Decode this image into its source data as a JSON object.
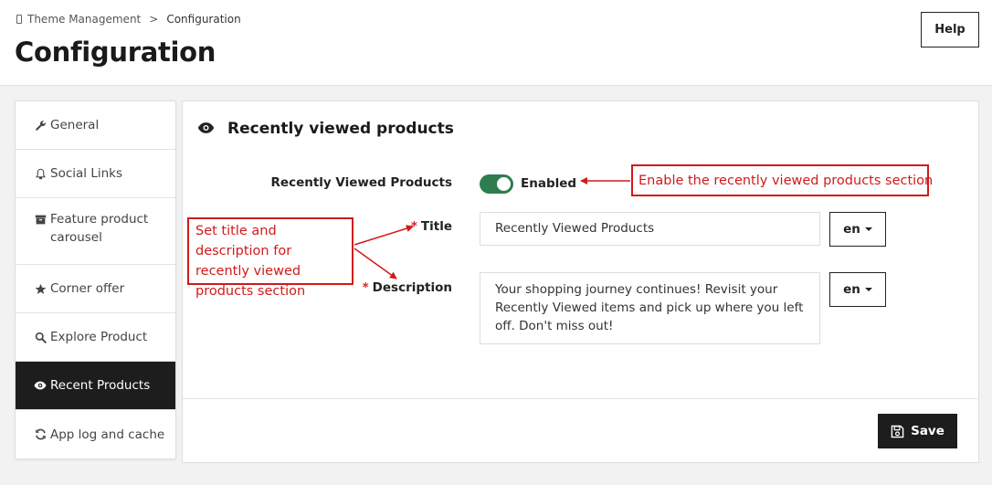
{
  "header": {
    "breadcrumb_root": "Theme Management",
    "breadcrumb_separator": ">",
    "breadcrumb_current": "Configuration",
    "page_title": "Configuration",
    "help_label": "Help"
  },
  "sidebar": {
    "items": [
      {
        "label": "General",
        "icon": "wrench-icon",
        "active": false
      },
      {
        "label": "Social Links",
        "icon": "bell-icon",
        "active": false
      },
      {
        "label": "Feature product carousel",
        "icon": "archive-icon",
        "active": false
      },
      {
        "label": "Corner offer",
        "icon": "star-icon",
        "active": false
      },
      {
        "label": "Explore Product",
        "icon": "search-icon",
        "active": false
      },
      {
        "label": "Recent Products",
        "icon": "eye-icon",
        "active": true
      },
      {
        "label": "App log and cache",
        "icon": "refresh-icon",
        "active": false
      }
    ]
  },
  "panel": {
    "title": "Recently viewed products",
    "title_icon": "eye-icon",
    "toggle_label": "Recently Viewed Products",
    "toggle_state": "Enabled",
    "title_label": "Title",
    "title_value": "Recently Viewed Products",
    "description_label": "Description",
    "description_value": "Your shopping journey continues! Revisit your Recently Viewed items and pick up where you left off. Don't miss out!",
    "required_marker": "*",
    "lang_title": "en",
    "lang_description": "en",
    "save_label": "Save"
  },
  "annotations": {
    "enable_note": "Enable the recently viewed products section",
    "title_desc_note": "Set title and description for recently viewed products section"
  },
  "colors": {
    "accent_dark": "#1d1d1d",
    "toggle_on": "#2e7d4f",
    "annotation_red": "#d11a1a",
    "required_red": "#d22"
  }
}
